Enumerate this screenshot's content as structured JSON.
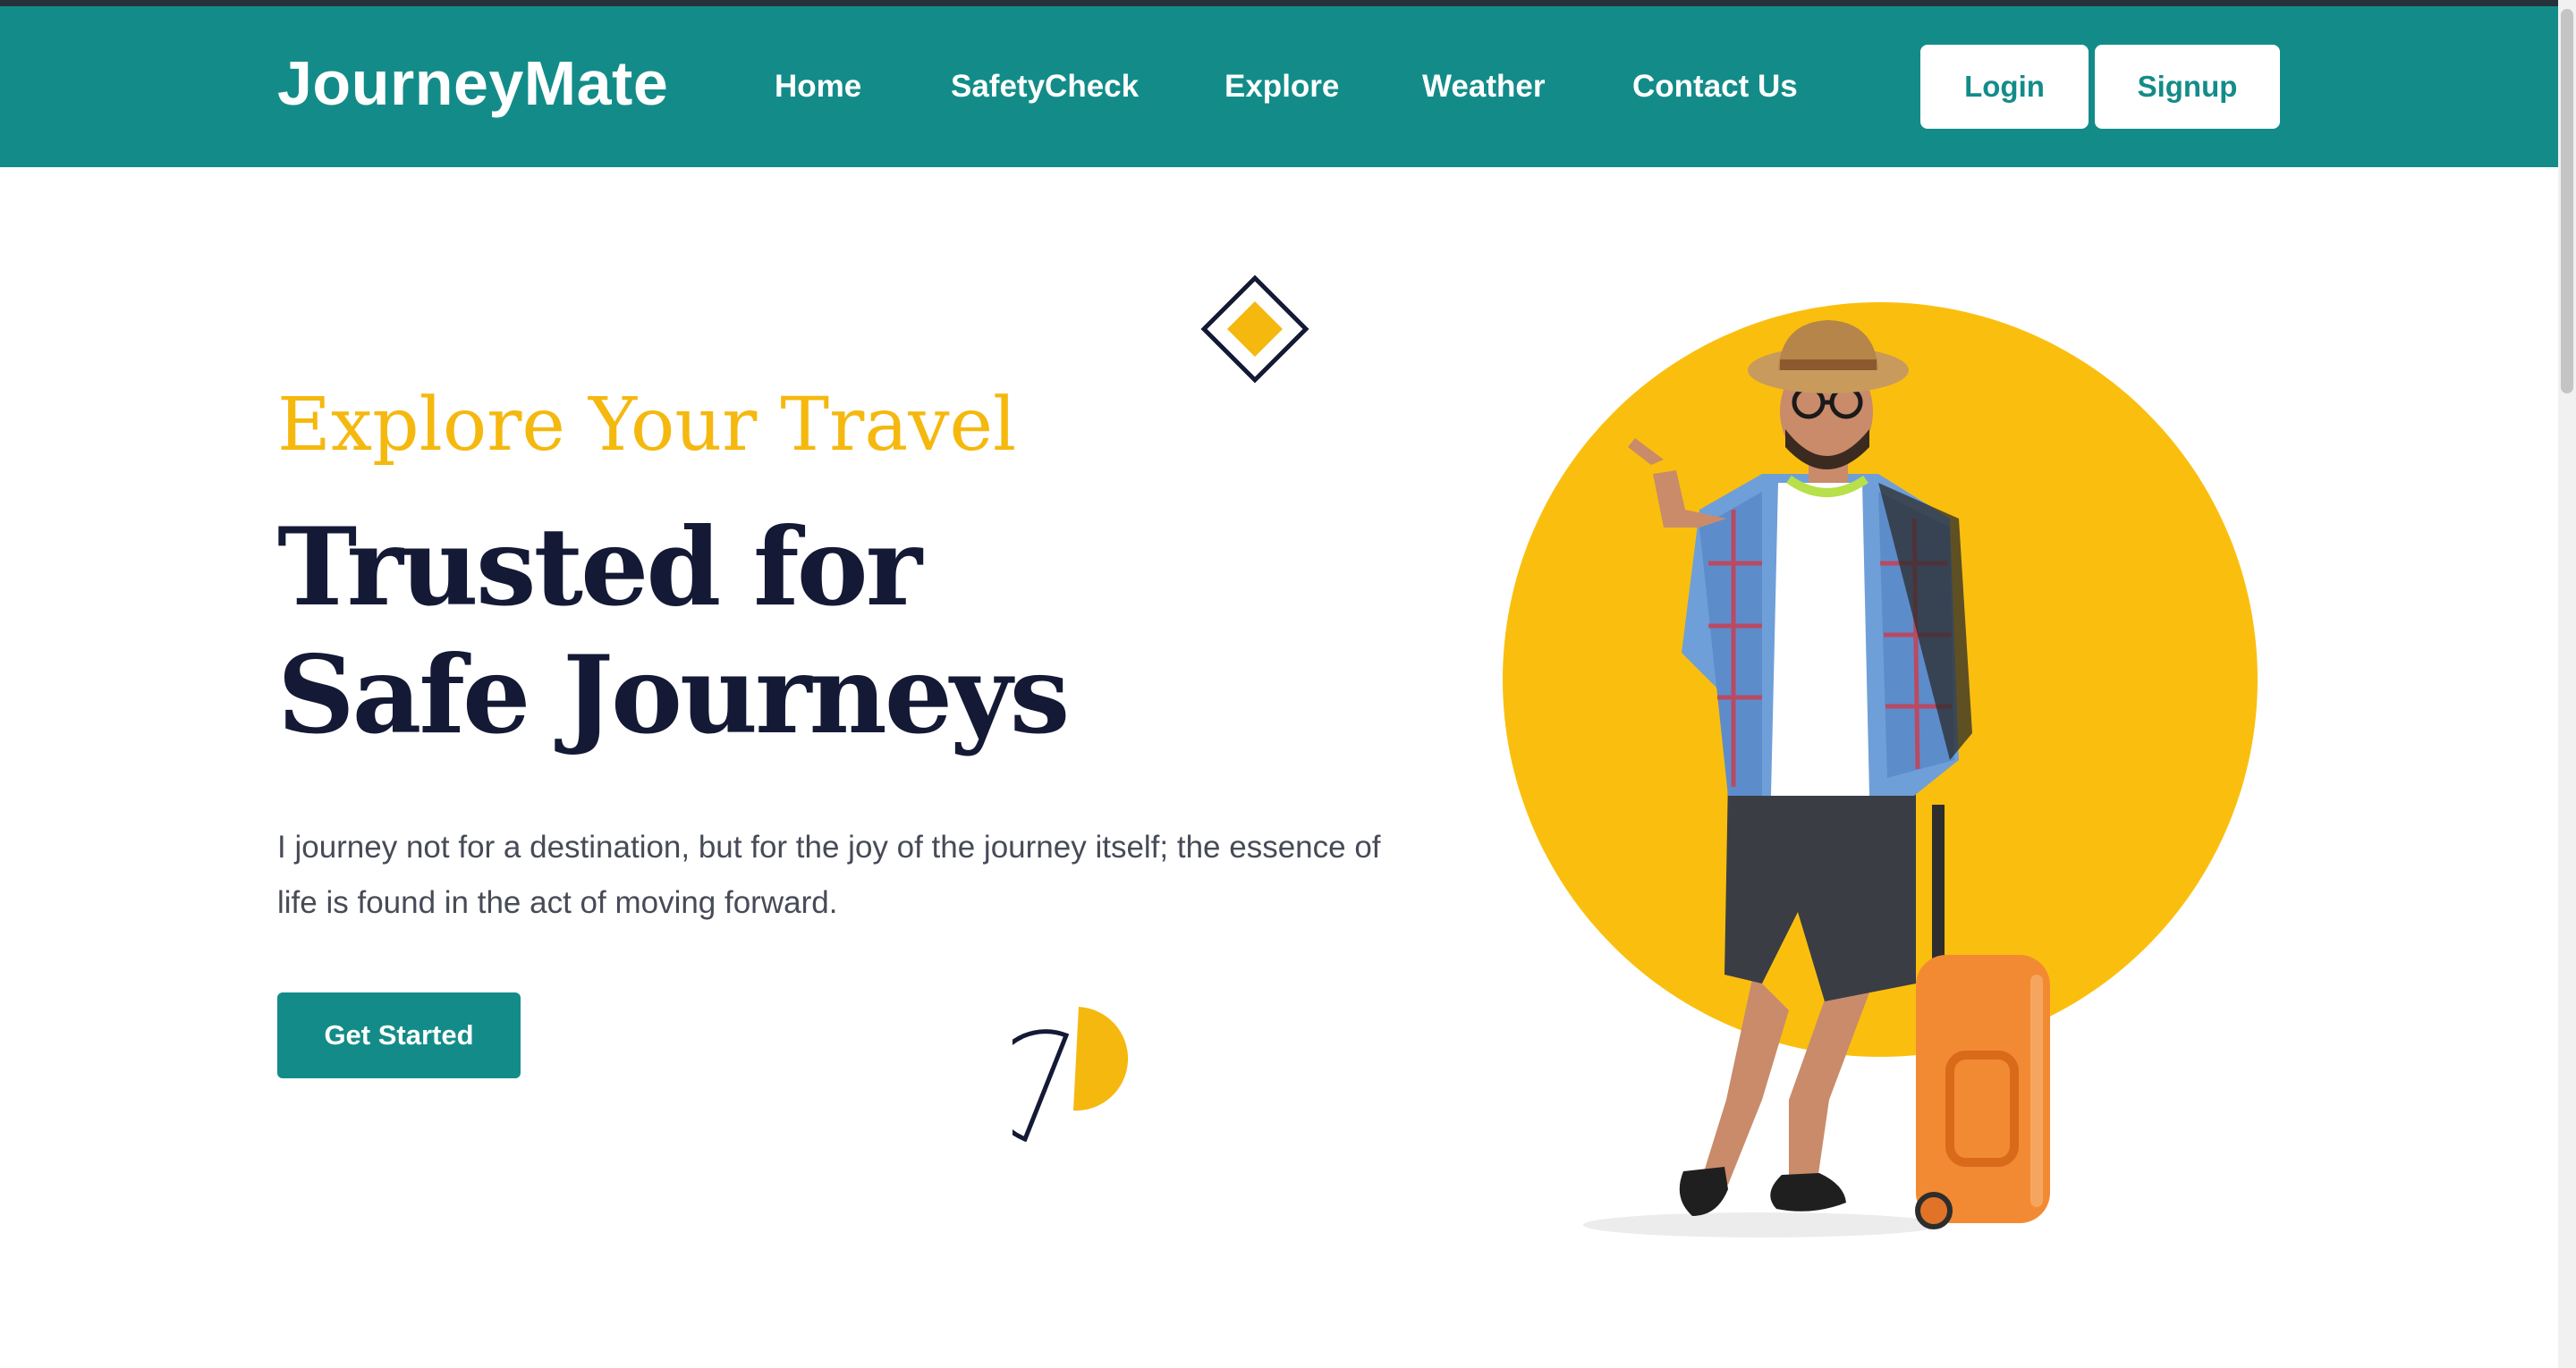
{
  "navbar": {
    "brand": "JourneyMate",
    "links": [
      {
        "label": "Home"
      },
      {
        "label": "SafetyCheck"
      },
      {
        "label": "Explore"
      },
      {
        "label": "Weather"
      },
      {
        "label": "Contact Us"
      }
    ],
    "login_label": "Login",
    "signup_label": "Signup"
  },
  "hero": {
    "subtitle": "Explore Your Travel",
    "title_line1": "Trusted for",
    "title_line2": "Safe Journeys",
    "description": "I journey not for a destination, but for the joy of the journey itself; the essence of life is found in the act of moving forward.",
    "cta_label": "Get Started"
  },
  "colors": {
    "brand": "#138c89",
    "accent": "#f5b80f",
    "heading": "#141a35",
    "text": "#474b57"
  },
  "icons": [
    "diamond-decoration-icon",
    "half-circle-decoration-icon"
  ]
}
